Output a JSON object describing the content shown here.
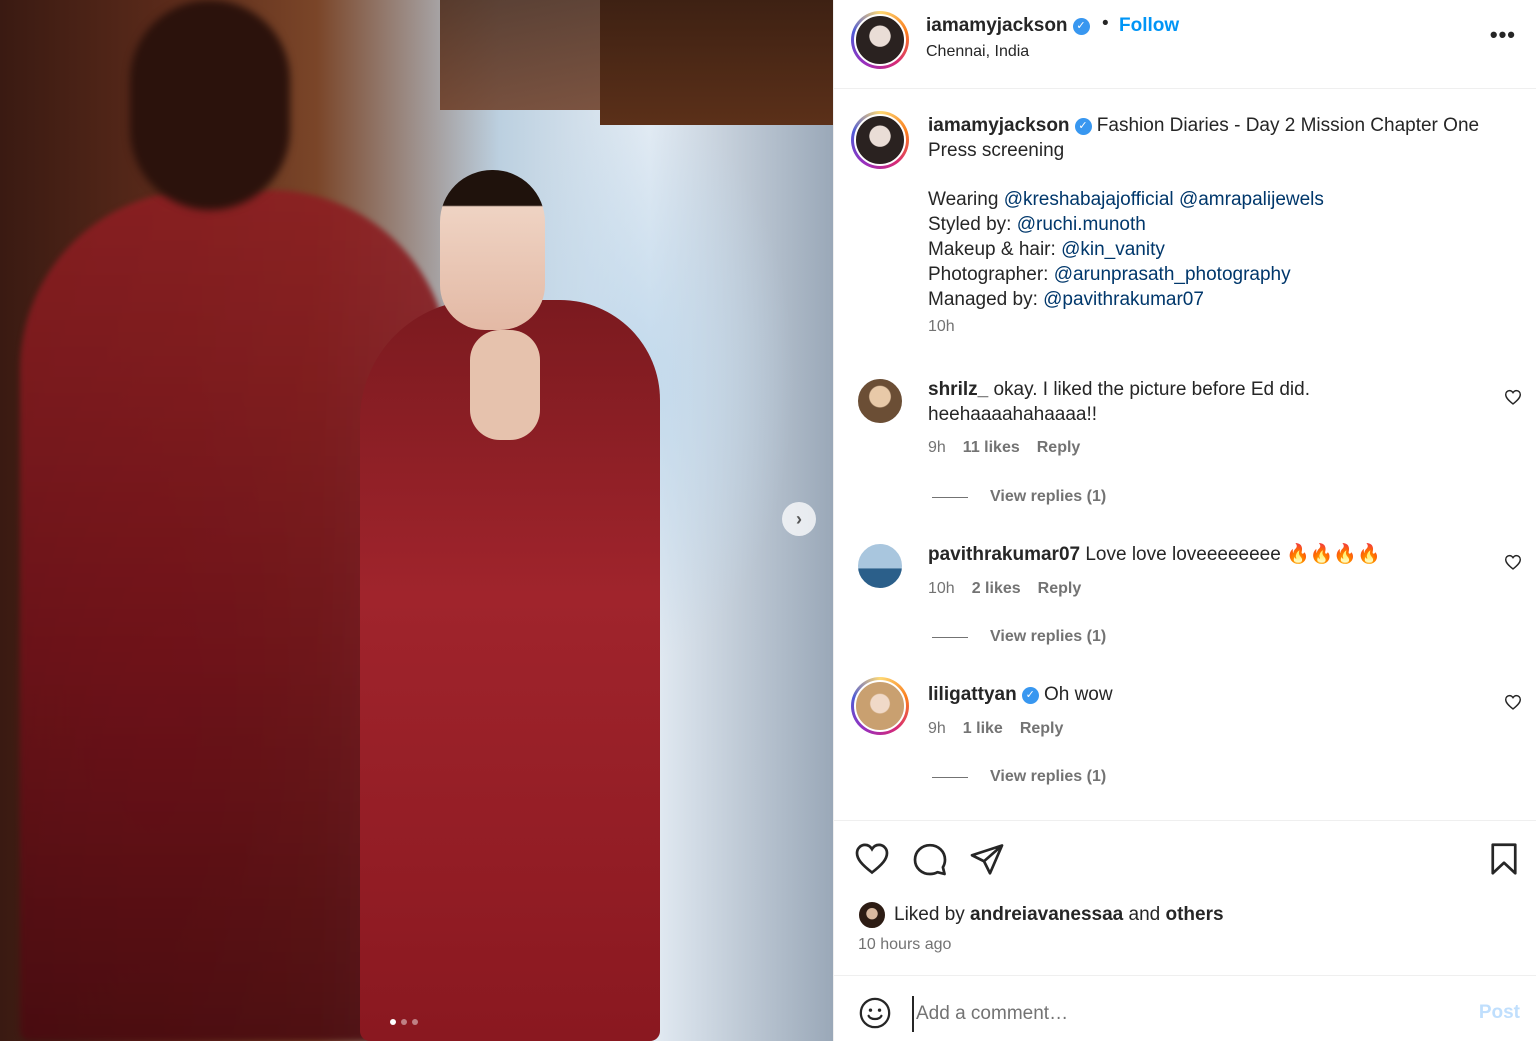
{
  "post": {
    "username": "iamamyjackson",
    "location": "Chennai, India",
    "follow_label": "Follow",
    "separator": "•",
    "more_label": "•••",
    "carousel_next": "›"
  },
  "caption": {
    "username": "iamamyjackson",
    "title_text": " Fashion Diaries - Day 2 Mission Chapter One Press screening",
    "wearing_label": "Wearing ",
    "wearing_mention1": "@kreshabajajofficial",
    "wearing_mention2": "@amrapalijewels",
    "styled_label": "Styled by: ",
    "styled_mention": "@ruchi.munoth",
    "makeup_label": "Makeup & hair: ",
    "makeup_mention": "@kin_vanity",
    "photographer_label": "Photographer: ",
    "photographer_mention": "@arunprasath_photography",
    "managed_label": "Managed by: ",
    "managed_mention": "@pavithrakumar07",
    "time": "10h"
  },
  "comments": [
    {
      "username": "shrilz_",
      "text": " okay. I liked the picture before Ed did. heehaaaahahaaaa!!",
      "time": "9h",
      "likes": "11 likes",
      "reply": "Reply",
      "view_replies": "View replies (1)"
    },
    {
      "username": "pavithrakumar07",
      "text": " Love love loveeeeeeee 🔥🔥🔥🔥",
      "time": "10h",
      "likes": "2 likes",
      "reply": "Reply",
      "view_replies": "View replies (1)"
    },
    {
      "username": "liligattyan",
      "text": " Oh wow",
      "time": "9h",
      "likes": "1 like",
      "reply": "Reply",
      "view_replies": "View replies (1)"
    }
  ],
  "likes": {
    "prefix": "Liked by ",
    "user": "andreiavanessaa",
    "middle": " and ",
    "others": "others",
    "time_ago": "10 hours ago"
  },
  "comment_box": {
    "placeholder": "Add a comment…",
    "post_label": "Post"
  },
  "colors": {
    "accent": "#0095f6",
    "mention": "#00376b",
    "verified": "#3897f0",
    "muted": "#737373"
  },
  "icons": {
    "verified": "verified-badge-icon",
    "like": "heart-icon",
    "comment": "comment-bubble-icon",
    "share": "paper-plane-icon",
    "save": "bookmark-icon",
    "emoji": "smiley-icon"
  }
}
